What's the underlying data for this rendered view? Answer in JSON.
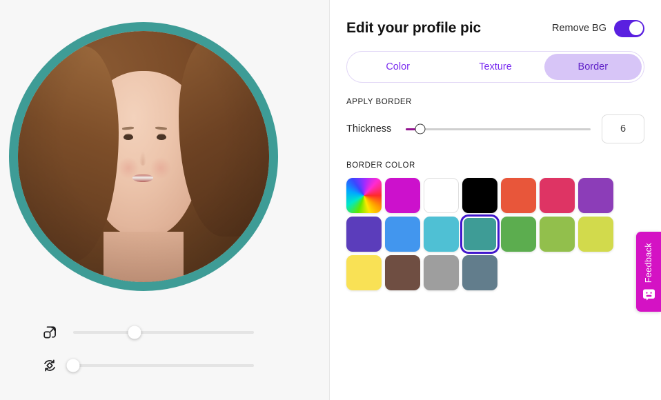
{
  "preview": {
    "avatar": {
      "alt": "profile-photo-woman",
      "border_color": "#3e9c96",
      "border_width_px": 13
    },
    "controls": [
      {
        "icon": "resize-icon",
        "name": "scale-slider",
        "value_pct": 34
      },
      {
        "icon": "rotate-icon",
        "name": "rotate-slider",
        "value_pct": 0
      }
    ]
  },
  "panel": {
    "title": "Edit your profile pic",
    "remove_bg": {
      "label": "Remove BG",
      "enabled": true,
      "on_color": "#5a20e0"
    },
    "tabs": [
      {
        "label": "Color",
        "active": false
      },
      {
        "label": "Texture",
        "active": false
      },
      {
        "label": "Border",
        "active": true
      }
    ],
    "apply_border": {
      "section_label": "APPLY BORDER",
      "thickness_label": "Thickness",
      "thickness_value": "6",
      "slider_pct": 8,
      "fill_color": "#93128f"
    },
    "border_color": {
      "section_label": "BORDER COLOR",
      "selected_index": 10,
      "swatches": [
        {
          "name": "rainbow",
          "color": "rainbow"
        },
        {
          "name": "magenta",
          "color": "#cc11cc"
        },
        {
          "name": "white",
          "color": "#ffffff"
        },
        {
          "name": "black",
          "color": "#000000"
        },
        {
          "name": "orange-red",
          "color": "#e8563a"
        },
        {
          "name": "crimson-pink",
          "color": "#de3464"
        },
        {
          "name": "purple",
          "color": "#8c3db8"
        },
        {
          "name": "indigo",
          "color": "#5b3dbb"
        },
        {
          "name": "blue",
          "color": "#4296ee"
        },
        {
          "name": "cyan",
          "color": "#4fc0d4"
        },
        {
          "name": "teal",
          "color": "#3e9c96"
        },
        {
          "name": "green",
          "color": "#5cad4f"
        },
        {
          "name": "yellow-green",
          "color": "#92bf4c"
        },
        {
          "name": "lime",
          "color": "#d2da4c"
        },
        {
          "name": "yellow",
          "color": "#f9e155"
        },
        {
          "name": "brown",
          "color": "#6f4e42"
        },
        {
          "name": "gray",
          "color": "#9e9e9e"
        },
        {
          "name": "slate",
          "color": "#627d8c"
        }
      ]
    }
  },
  "feedback": {
    "label": "Feedback",
    "icon": "smiley-chat-icon",
    "color": "#d412c4"
  }
}
